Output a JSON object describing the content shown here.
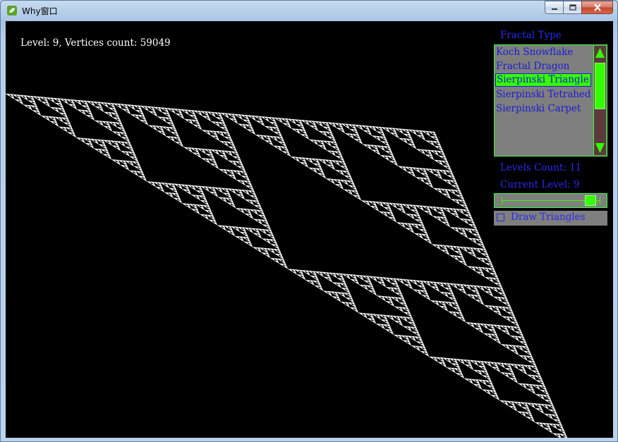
{
  "window": {
    "title": "Why窗口",
    "icon": "app-leaf-icon",
    "minimize_icon": "minimize-icon",
    "maximize_icon": "maximize-icon",
    "close_icon": "close-icon"
  },
  "status": {
    "text": "Level: 9, Vertices count: 59049"
  },
  "panel": {
    "fractal_type_label": "Fractal Type",
    "fractal_types": [
      "Koch Snowflake",
      "Fractal Dragon",
      "Sierpinski Triangle",
      "Sierpinski Tetrahedron",
      "Sierpinski Carpet"
    ],
    "selected_type": "Sierpinski Triangle",
    "levels_count_label": "Levels Count: 11",
    "current_level_label": "Current Level: 9",
    "current_level": 9,
    "levels_count": 11,
    "draw_triangles_label": "Draw Triangles",
    "draw_triangles_checked": false
  },
  "colors": {
    "accent_green": "#33ff00",
    "label_blue": "#2a2af0",
    "panel_gray": "#7f7f7f",
    "canvas_bg": "#000000",
    "fractal": "#ffffff"
  }
}
